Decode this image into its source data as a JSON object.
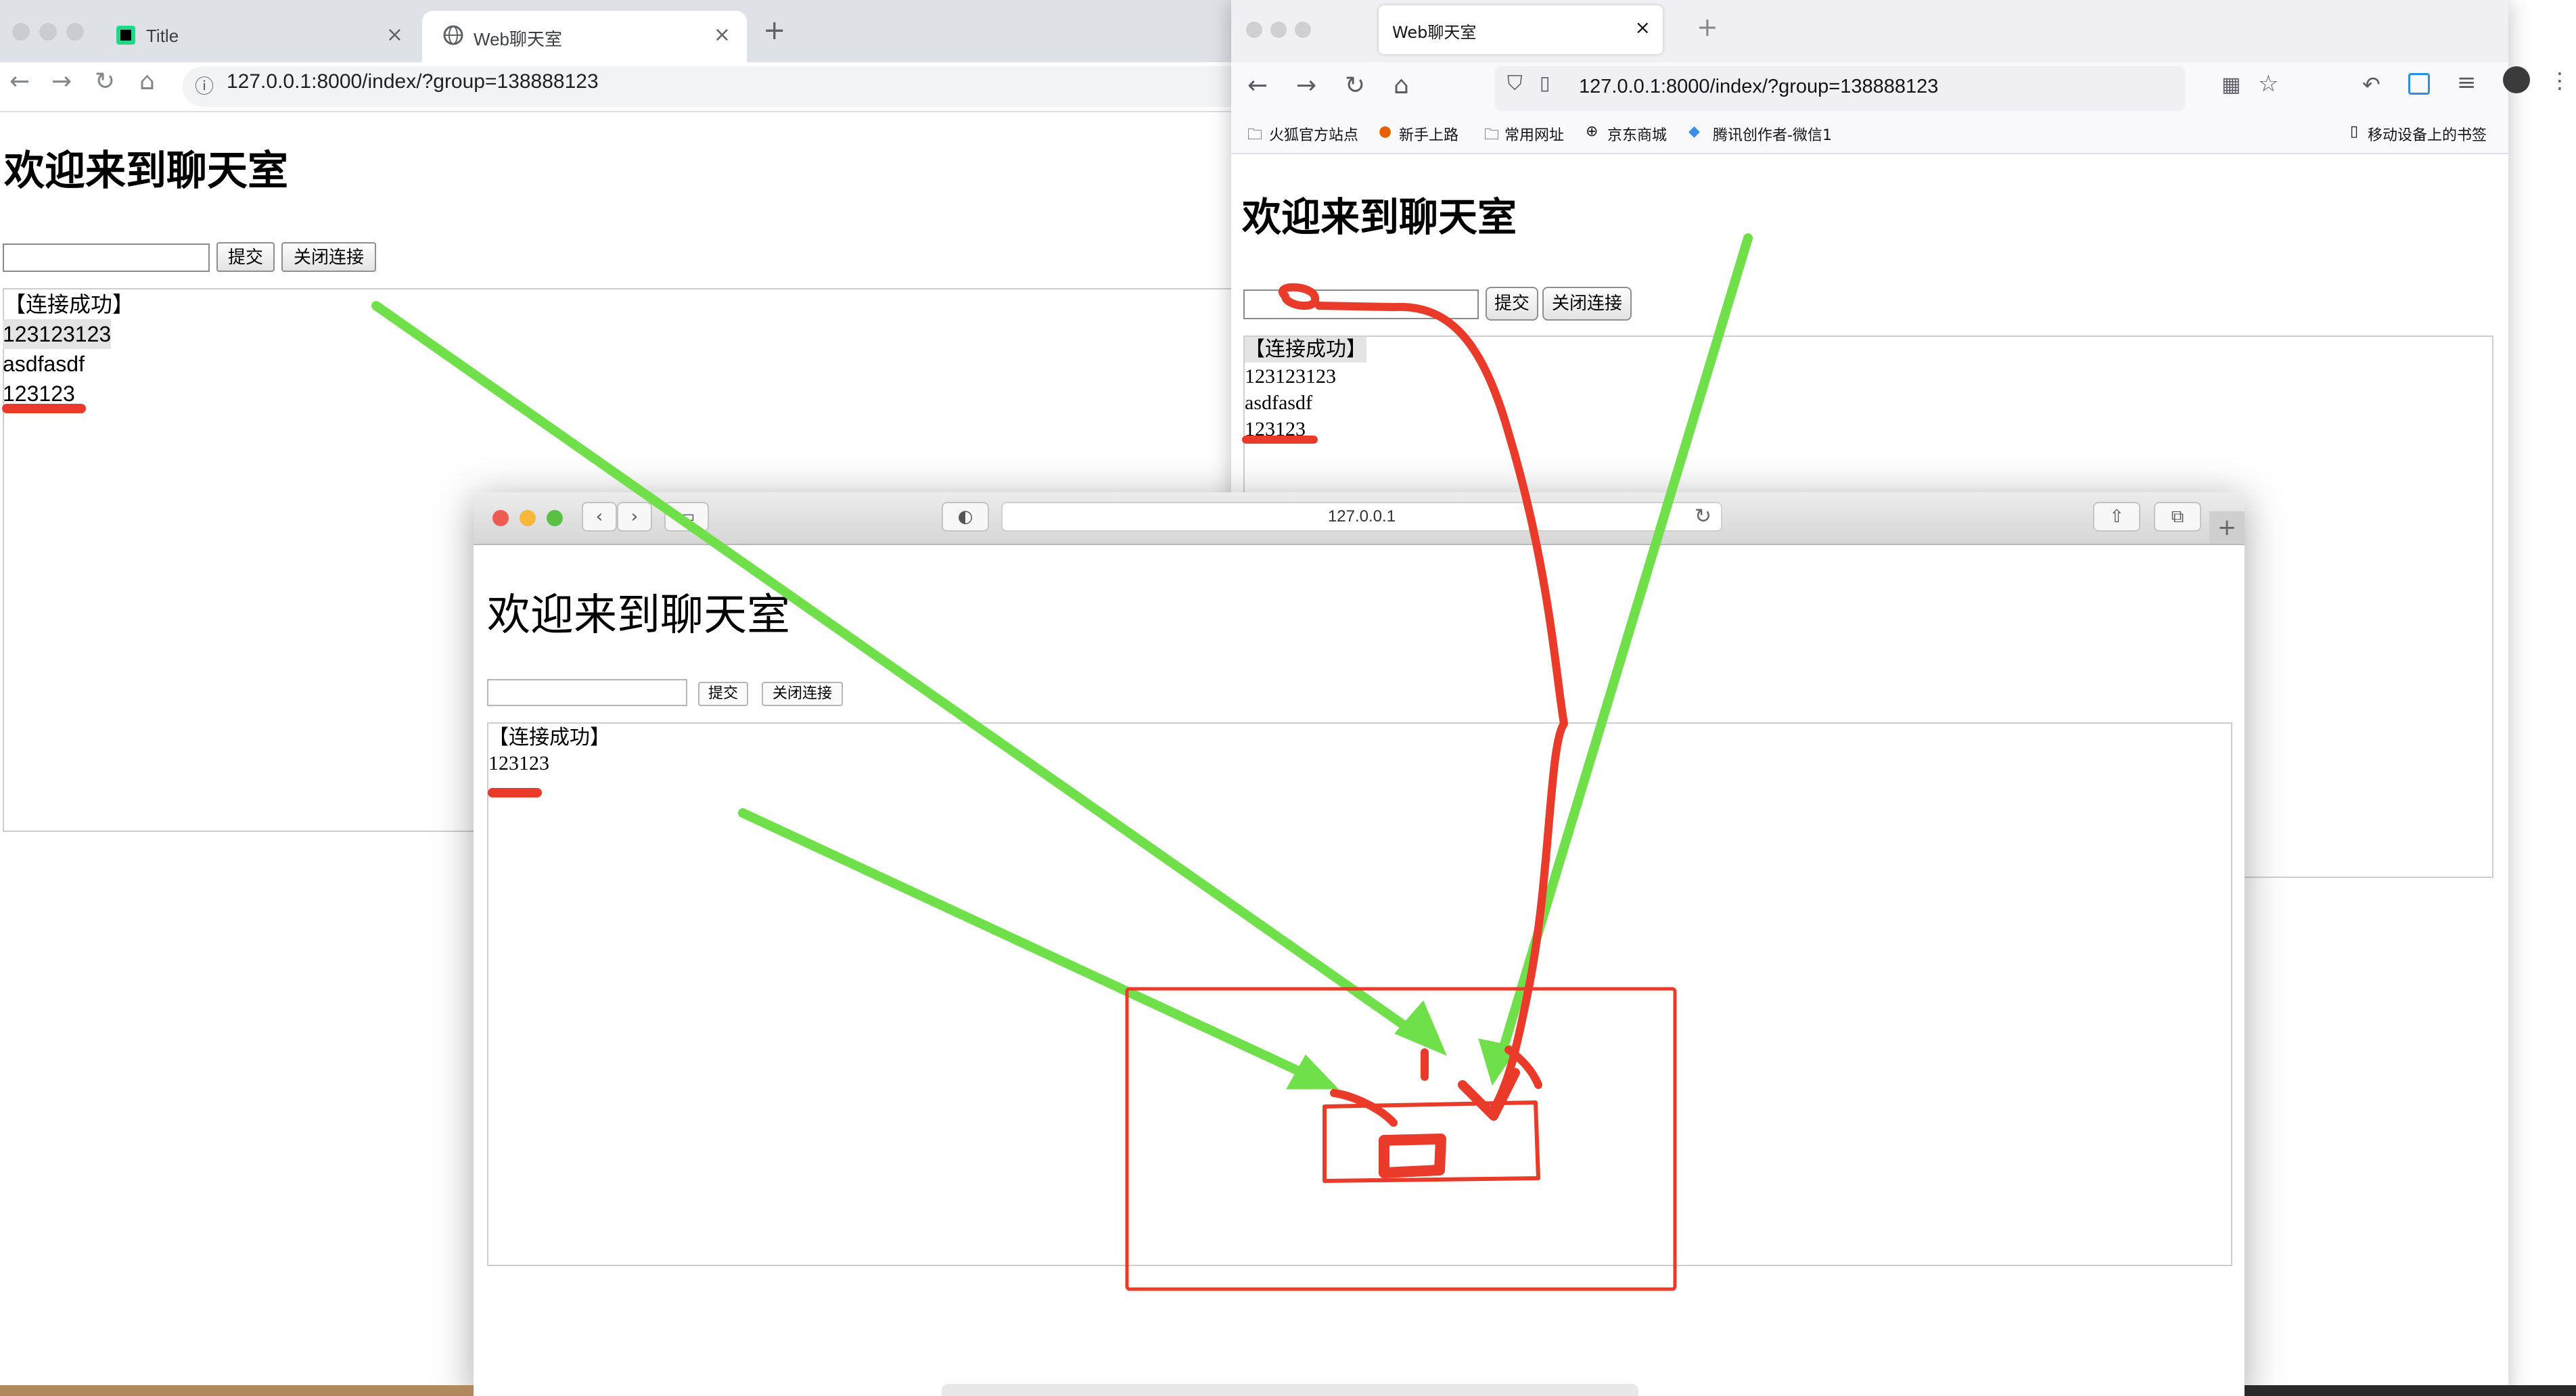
{
  "chrome": {
    "tabs": [
      {
        "label": "Title"
      },
      {
        "label": "Web聊天室"
      }
    ],
    "new_tab": "+",
    "url": "127.0.0.1:8000/index/?group=138888123",
    "page": {
      "heading": "欢迎来到聊天室",
      "submit_label": "提交",
      "close_label": "关闭连接",
      "input_value": "",
      "messages": [
        "【连接成功】",
        "123123123",
        "asdfasdf",
        "123123"
      ]
    }
  },
  "firefox": {
    "tab": {
      "label": "Web聊天室"
    },
    "new_tab": "+",
    "url": "127.0.0.1:8000/index/?group=138888123",
    "bookmarks": [
      "火狐官方站点",
      "新手上路",
      "常用网址",
      "京东商城",
      "腾讯创作者-微信1"
    ],
    "mobile_bookmarks": "移动设备上的书签",
    "page": {
      "heading": "欢迎来到聊天室",
      "submit_label": "提交",
      "close_label": "关闭连接",
      "input_value": "",
      "messages": [
        "【连接成功】",
        "123123123",
        "asdfasdf",
        "123123"
      ]
    }
  },
  "safari": {
    "address": "127.0.0.1",
    "page": {
      "heading": "欢迎来到聊天室",
      "submit_label": "提交",
      "close_label": "关闭连接",
      "input_value": "",
      "messages": [
        "【连接成功】",
        "123123"
      ]
    }
  },
  "annotation_colors": {
    "arrow": "#6fe04a",
    "markup": "#ea3a2a"
  }
}
